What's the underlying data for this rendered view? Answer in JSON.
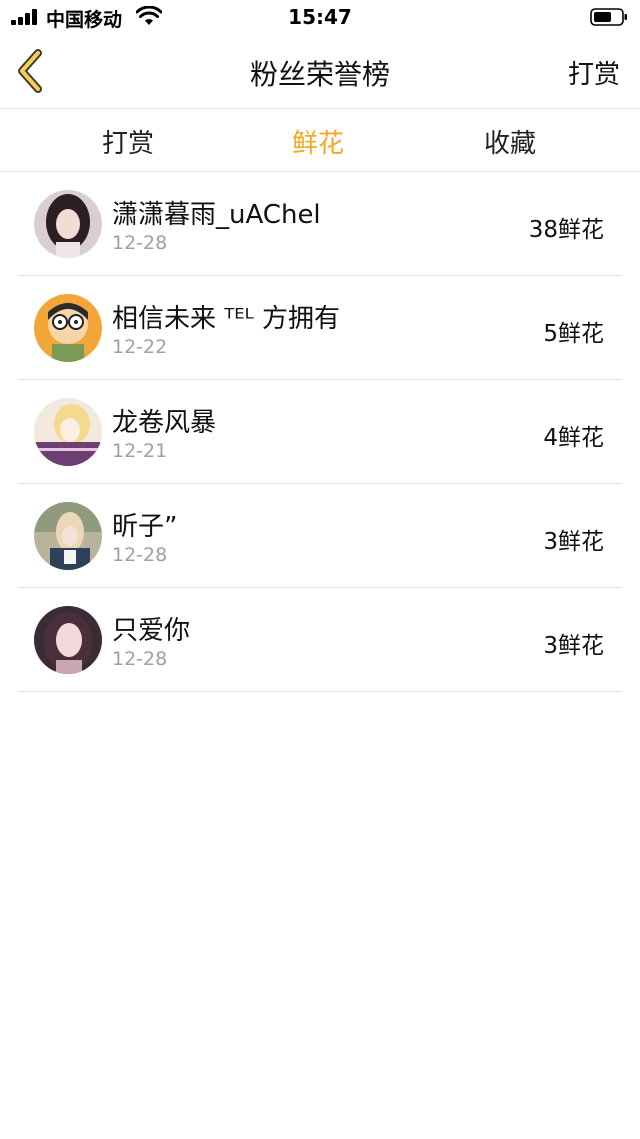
{
  "status_bar": {
    "carrier": "中国移动",
    "time": "15:47"
  },
  "nav": {
    "title": "粉丝荣誉榜",
    "right_action": "打赏",
    "accent_color": "#f5a623"
  },
  "tabs": [
    {
      "label": "打赏",
      "active": false
    },
    {
      "label": "鲜花",
      "active": true
    },
    {
      "label": "收藏",
      "active": false
    }
  ],
  "list": [
    {
      "name": "潇潇暮雨_uAChel",
      "date": "12-28",
      "count": "38鲜花"
    },
    {
      "name": "相信未来 ᵀᴱᴸ 方拥有",
      "date": "12-22",
      "count": "5鲜花"
    },
    {
      "name": "龙卷风暴",
      "date": "12-21",
      "count": "4鲜花"
    },
    {
      "name": "昕子”",
      "date": "12-28",
      "count": "3鲜花"
    },
    {
      "name": "只爱你",
      "date": "12-28",
      "count": "3鲜花"
    }
  ]
}
